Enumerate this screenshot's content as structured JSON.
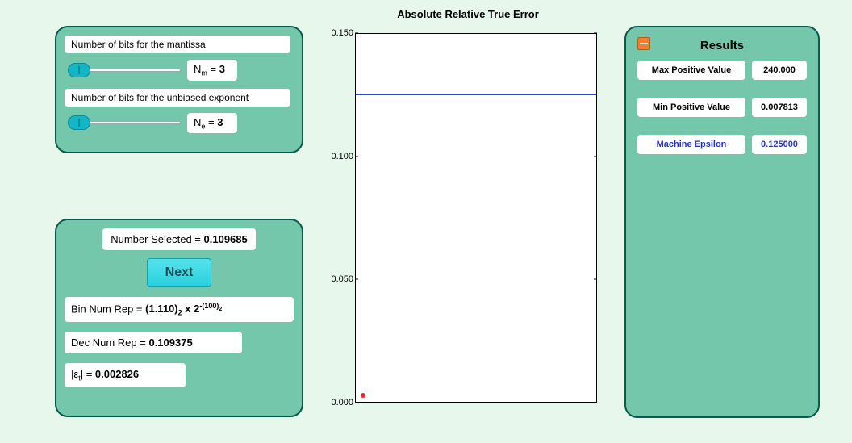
{
  "sliders": {
    "mantissa": {
      "label": "Number of bits for the mantissa",
      "var_html": "N<sub class='sub'>m</sub> =",
      "value": "3"
    },
    "exponent": {
      "label": "Number of bits for the unbiased exponent",
      "var_html": "N<sub class='sub'>e</sub> =",
      "value": "3"
    }
  },
  "selected": {
    "label": "Number Selected =",
    "value": "0.109685"
  },
  "next_label": "Next",
  "bin_rep": {
    "label": "Bin Num Rep =",
    "value_html": "(1.110)<sub class='sub'>2</sub> x 2<sup class='sup'>-(100)<sub class='sub' style='font-size:7px'>2</sub></sup>"
  },
  "dec_rep": {
    "label": "Dec Num Rep =",
    "value": "0.109375"
  },
  "epsilon": {
    "label_html": "|ε<sub class='sub'>t</sub>| =",
    "value": "0.002826"
  },
  "results": {
    "title": "Results",
    "max_pos": {
      "label": "Max Positive Value",
      "value": "240.000"
    },
    "min_pos": {
      "label": "Min Positive Value",
      "value": "0.007813"
    },
    "mach_eps": {
      "label": "Machine Epsilon",
      "value": "0.125000"
    }
  },
  "chart_data": {
    "type": "scatter",
    "title": "Absolute Relative True Error",
    "ylim": [
      0.0,
      0.15
    ],
    "yticks": [
      "0.000",
      "0.050",
      "0.100",
      "0.150"
    ],
    "reference_line_y": 0.125,
    "points": [
      {
        "x_index": 0,
        "y": 0.002826
      }
    ]
  }
}
